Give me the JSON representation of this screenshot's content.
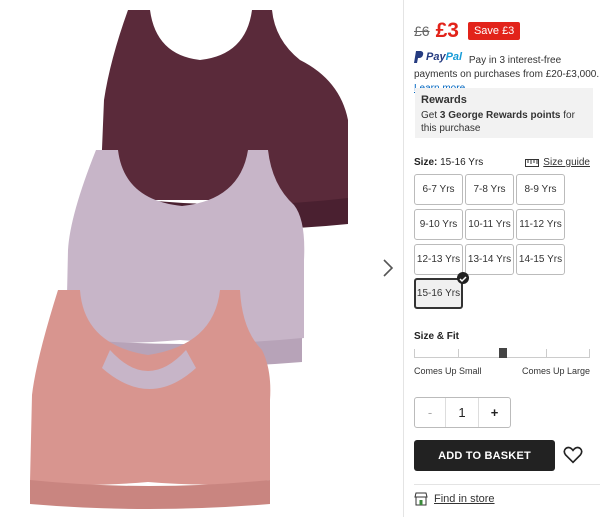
{
  "gallery": {
    "next_icon": "chevron-right-icon",
    "image_colors": {
      "plum": "#5a2a3a",
      "lilac": "#c7b5c8",
      "pink": "#d8958f"
    }
  },
  "price": {
    "was": "£6",
    "now": "£3",
    "save": "Save £3",
    "now_color": "#e2231a"
  },
  "paypal": {
    "logo_pay": "Pay",
    "logo_pal": "Pal",
    "text": "Pay in 3 interest-free payments on purchases from £20-£3,000.",
    "link": "Learn more"
  },
  "rewards": {
    "title": "Rewards",
    "text_prefix": "Get ",
    "points": "3 George Rewards points",
    "text_suffix": " for this purchase"
  },
  "size": {
    "label": "Size:",
    "selected": "15-16 Yrs",
    "guide_label": "Size guide",
    "guide_icon": "ruler-icon",
    "options": [
      "6-7 Yrs",
      "7-8 Yrs",
      "8-9 Yrs",
      "9-10 Yrs",
      "10-11 Yrs",
      "11-12 Yrs",
      "12-13 Yrs",
      "13-14 Yrs",
      "14-15 Yrs",
      "15-16 Yrs"
    ]
  },
  "fit": {
    "label": "Size & Fit",
    "left": "Comes Up Small",
    "right": "Comes Up Large",
    "value": 0.5
  },
  "quantity": {
    "minus": "-",
    "value": "1",
    "plus": "+"
  },
  "basket": {
    "label": "ADD TO BASKET",
    "wishlist_icon": "heart-icon"
  },
  "store": {
    "label": "Find in store",
    "icon": "store-icon"
  }
}
